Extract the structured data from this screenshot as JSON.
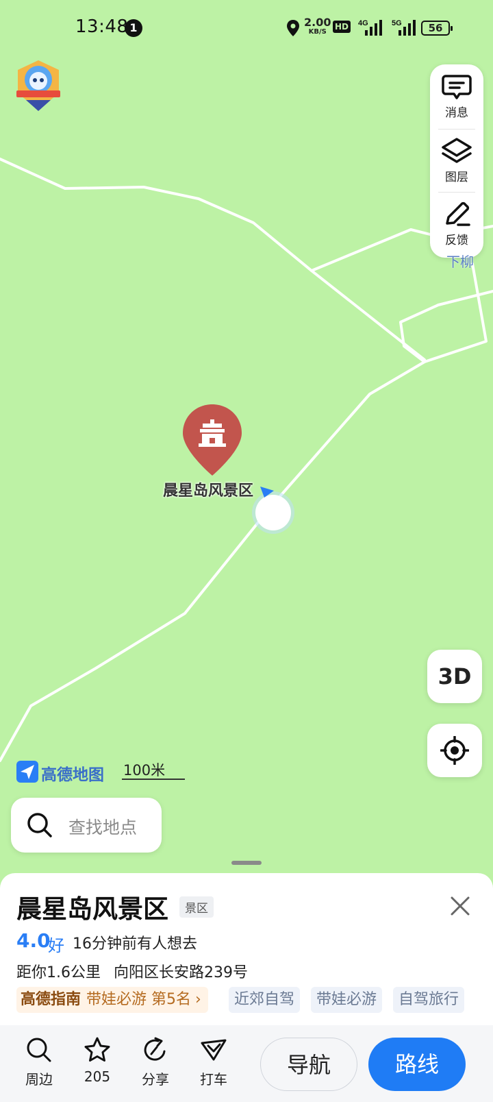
{
  "status_bar": {
    "time": "13:48",
    "notification_count": "1",
    "speed_value": "2.00",
    "speed_unit": "KB/S",
    "hd_badge": "HD",
    "network_1": "4G",
    "network_2": "5G",
    "battery": "56"
  },
  "toolbar": {
    "messages": "消息",
    "layers": "图层",
    "feedback": "反馈"
  },
  "map": {
    "place_label": "晨星岛风景区",
    "road_label": "下柳",
    "logo_text": "高德地图",
    "scale": "100米",
    "btn_3d": "3D"
  },
  "search": {
    "placeholder": "查找地点"
  },
  "poi": {
    "title": "晨星岛风景区",
    "category": "景区",
    "rating": "4.0",
    "rating_word": "好",
    "recent": "16分钟前有人想去",
    "distance": "距你1.6公里",
    "address": "向阳区长安路239号",
    "rank_brand": "高德指南",
    "rank_text": "带娃必游 第5名",
    "tags": [
      "近郊自驾",
      "带娃必游",
      "自驾旅行"
    ]
  },
  "actions": {
    "nearby": "周边",
    "favorite_count": "205",
    "share": "分享",
    "taxi": "打车",
    "navigate": "导航",
    "route": "路线"
  },
  "colors": {
    "map_bg": "#bdf2a5",
    "accent_blue": "#1f7cf5",
    "poi_marker": "#c2554d"
  }
}
